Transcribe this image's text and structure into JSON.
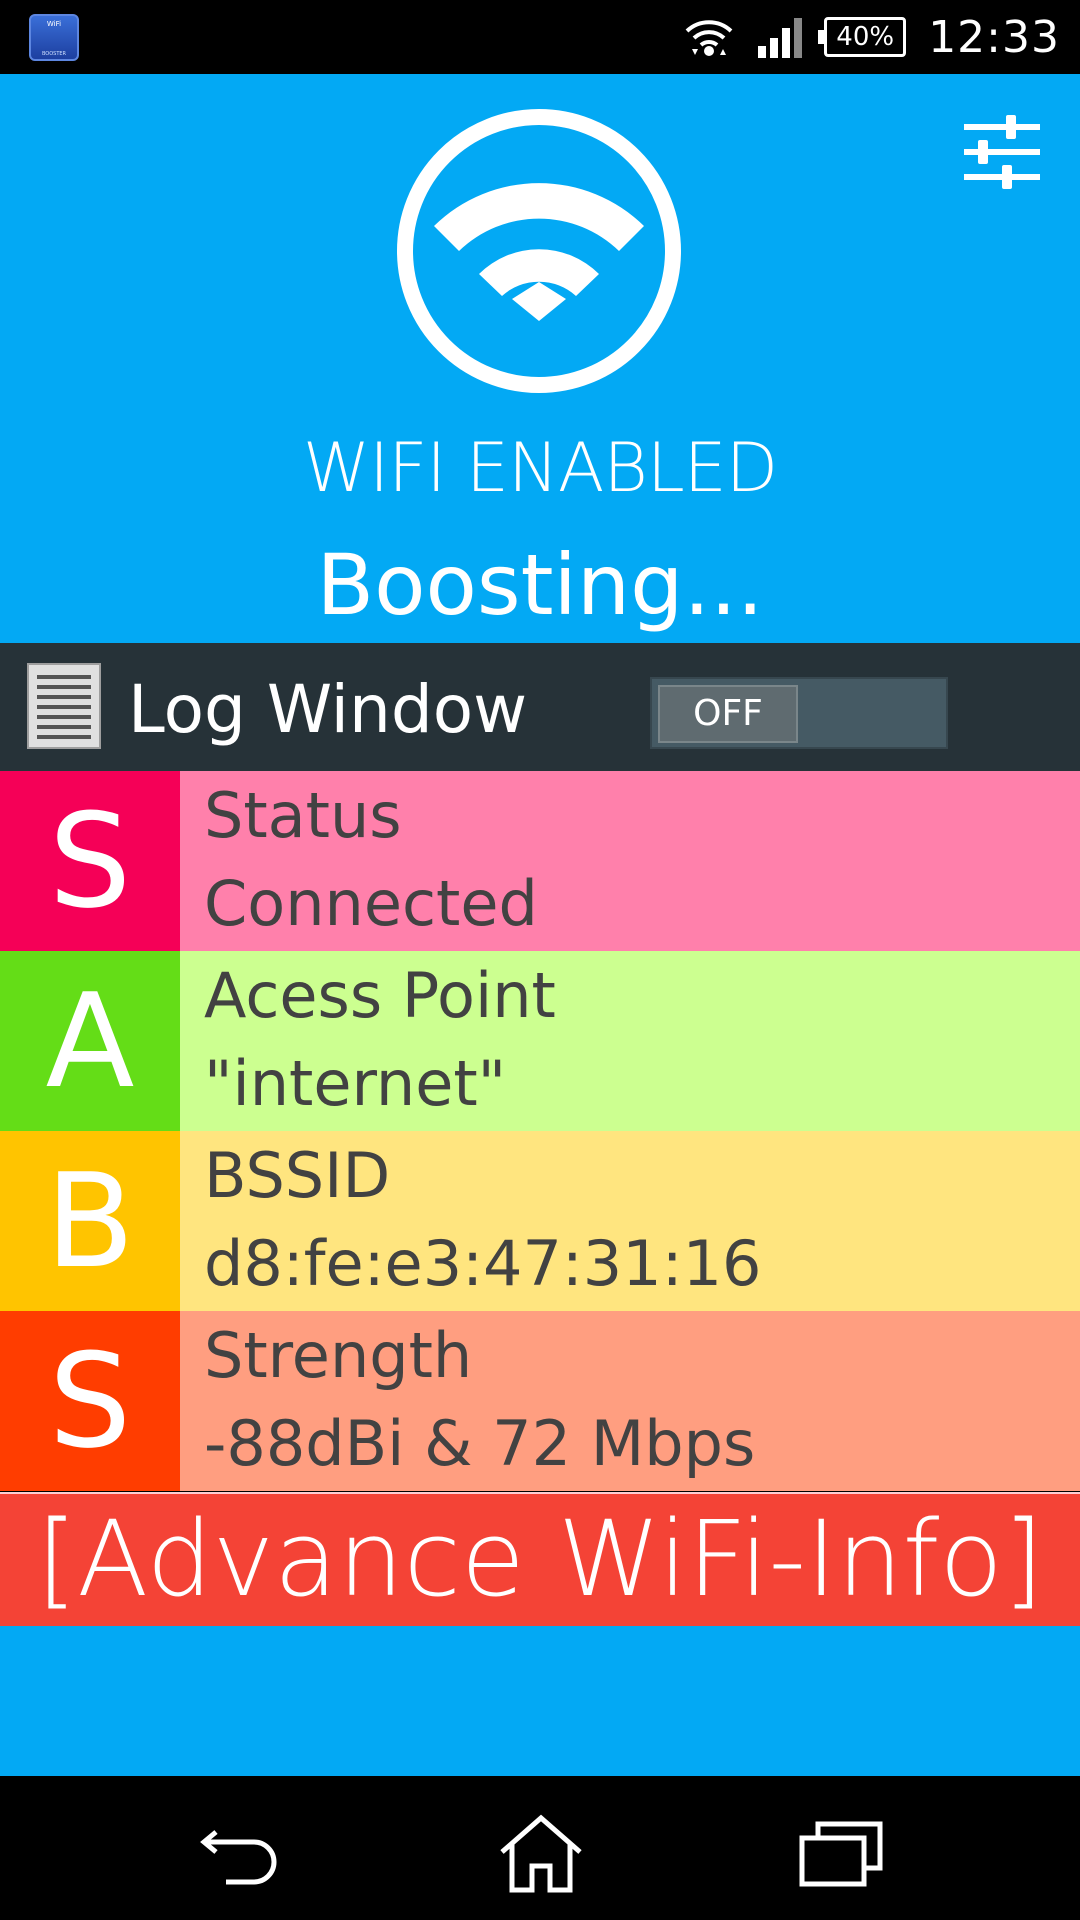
{
  "statusbar": {
    "app_icon_top": "WiFi",
    "app_icon_bottom": "BOOSTER",
    "battery": "40%",
    "time": "12:33"
  },
  "header": {
    "wifi_status": "WIFI ENABLED",
    "boost_status": "Boosting..."
  },
  "log_window": {
    "label": "Log Window",
    "toggle_state": "OFF"
  },
  "rows": [
    {
      "letter": "S",
      "title": "Status",
      "value": "Connected",
      "letter_color": "#f50057",
      "bg_color": "#ff80ab"
    },
    {
      "letter": "A",
      "title": "Acess Point",
      "value": "\"internet\"",
      "letter_color": "#64dd17",
      "bg_color": "#ccff90"
    },
    {
      "letter": "B",
      "title": "BSSID",
      "value": "d8:fe:e3:47:31:16",
      "letter_color": "#ffc400",
      "bg_color": "#ffe57f"
    },
    {
      "letter": "S",
      "title": "Strength",
      "value": "-88dBi & 72 Mbps",
      "letter_color": "#ff3d00",
      "bg_color": "#ff9e80"
    }
  ],
  "advance_button": "[Advance WiFi-Info]",
  "colors": {
    "primary": "#03a9f4",
    "log_bar": "#263238",
    "advance": "#f44336"
  }
}
